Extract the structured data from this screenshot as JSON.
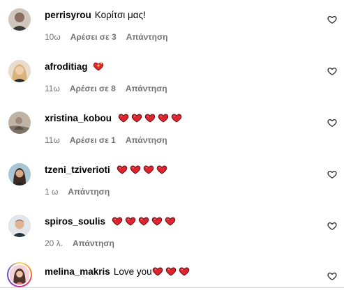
{
  "comments": [
    {
      "username": "perrisyrou",
      "text": "Κορίτσι μας!",
      "hearts": 0,
      "time": "10ω",
      "likes": "Αρέσει σε 3",
      "reply": "Απάντηση",
      "avatar_color": "#8d6e63"
    },
    {
      "username": "afroditiag",
      "text": "",
      "emoji": "sparkling-heart",
      "hearts": 0,
      "time": "11ω",
      "likes": "Αρέσει σε 8",
      "reply": "Απάντηση",
      "avatar_color": "#c9a27a"
    },
    {
      "username": "xristina_kobou",
      "text": "",
      "hearts": 5,
      "time": "11ω",
      "likes": "Αρέσει σε 1",
      "reply": "Απάντηση",
      "avatar_color": "#a1887f"
    },
    {
      "username": "tzeni_tziverioti",
      "text": "",
      "hearts": 4,
      "time": "1 ω",
      "likes": "",
      "reply": "Απάντηση",
      "avatar_color": "#5d4037"
    },
    {
      "username": "spiros_soulis",
      "text": "",
      "hearts": 5,
      "time": "20 λ.",
      "likes": "",
      "reply": "Απάντηση",
      "avatar_color": "#90a4ae"
    },
    {
      "username": "melina_makris",
      "text": "Love you",
      "hearts": 3,
      "time": "",
      "likes": "",
      "reply": "",
      "avatar_color": "#e57373",
      "story_ring": true
    }
  ],
  "colors": {
    "heart_red": "#e0242f",
    "meta_gray": "#737373",
    "divider": "#dbdbdb"
  },
  "icons": {
    "like": "heart-outline-icon",
    "emoji_heart": "red-heart-emoji",
    "sparkle_heart": "sparkling-heart-emoji"
  }
}
